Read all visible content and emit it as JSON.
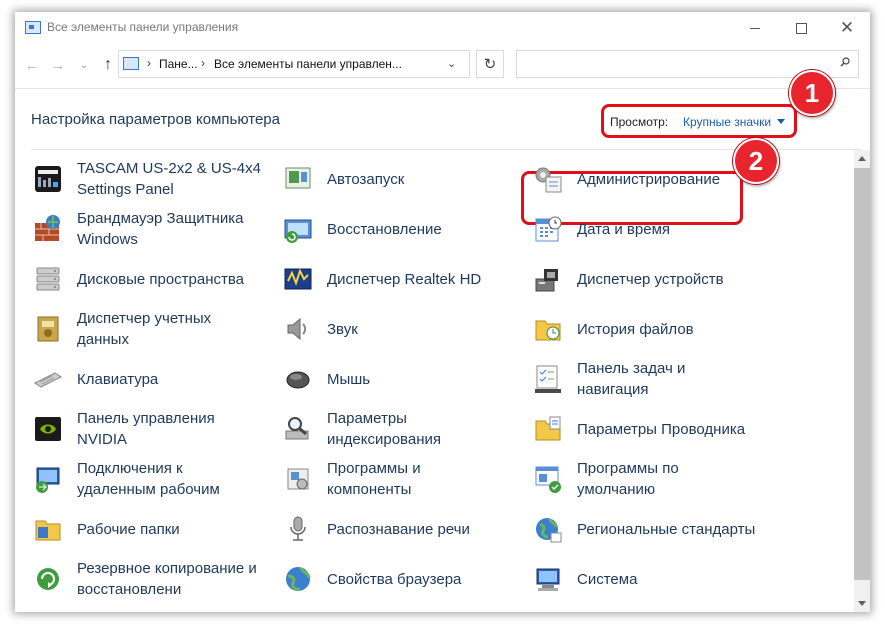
{
  "window": {
    "title": "Все элементы панели управления",
    "minimize_symbol": "",
    "maximize_symbol": "",
    "close_symbol": "✕"
  },
  "nav": {
    "back": "←",
    "forward": "→",
    "recent": "⌄",
    "up": "↑",
    "refresh": "↻"
  },
  "address": {
    "segment_1": "Пане...",
    "segment_2": "Все элементы панели управлен...",
    "chevron": "›",
    "dropdown": "⌄"
  },
  "search": {
    "placeholder": ""
  },
  "header": {
    "title": "Настройка параметров компьютера",
    "view_label": "Просмотр:",
    "view_value": "Крупные значки"
  },
  "badges": {
    "one": "1",
    "two": "2"
  },
  "items": [
    {
      "label_1": "TASCAM US-2x2 & US-4x4",
      "label_2": "Settings Panel",
      "icon": "tascam-icon"
    },
    {
      "label_1": "Автозапуск",
      "icon": "autoplay-icon"
    },
    {
      "label_1": "Администрирование",
      "icon": "admin-tools-icon"
    },
    {
      "label_1": "Брандмауэр Защитника",
      "label_2": "Windows",
      "icon": "firewall-icon"
    },
    {
      "label_1": "Восстановление",
      "icon": "recovery-icon"
    },
    {
      "label_1": "Дата и время",
      "icon": "calendar-icon"
    },
    {
      "label_1": "Дисковые пространства",
      "icon": "storage-spaces-icon"
    },
    {
      "label_1": "Диспетчер Realtek HD",
      "icon": "realtek-icon"
    },
    {
      "label_1": "Диспетчер устройств",
      "icon": "device-manager-icon"
    },
    {
      "label_1": "Диспетчер учетных",
      "label_2": "данных",
      "icon": "credential-icon"
    },
    {
      "label_1": "Звук",
      "icon": "sound-icon"
    },
    {
      "label_1": "История файлов",
      "icon": "file-history-icon"
    },
    {
      "label_1": "Клавиатура",
      "icon": "keyboard-icon"
    },
    {
      "label_1": "Мышь",
      "icon": "mouse-icon"
    },
    {
      "label_1": "Панель задач и",
      "label_2": "навигация",
      "icon": "taskbar-icon"
    },
    {
      "label_1": "Панель управления",
      "label_2": "NVIDIA",
      "icon": "nvidia-icon"
    },
    {
      "label_1": "Параметры",
      "label_2": "индексирования",
      "icon": "indexing-icon"
    },
    {
      "label_1": "Параметры Проводника",
      "icon": "explorer-options-icon"
    },
    {
      "label_1": "Подключения к",
      "label_2": "удаленным рабочим",
      "icon": "remote-desktop-icon"
    },
    {
      "label_1": "Программы и",
      "label_2": "компоненты",
      "icon": "programs-icon"
    },
    {
      "label_1": "Программы по",
      "label_2": "умолчанию",
      "icon": "default-programs-icon"
    },
    {
      "label_1": "Рабочие папки",
      "icon": "work-folders-icon"
    },
    {
      "label_1": "Распознавание речи",
      "icon": "microphone-icon"
    },
    {
      "label_1": "Региональные стандарты",
      "icon": "region-icon"
    },
    {
      "label_1": "Резервное копирование и",
      "label_2": "восстановлени",
      "icon": "backup-icon"
    },
    {
      "label_1": "Свойства браузера",
      "icon": "internet-options-icon"
    },
    {
      "label_1": "Система",
      "icon": "system-icon"
    }
  ],
  "colors": {
    "link_text": "#1e395b",
    "view_value": "#1a5ea8",
    "highlight_red": "#e0101a"
  }
}
